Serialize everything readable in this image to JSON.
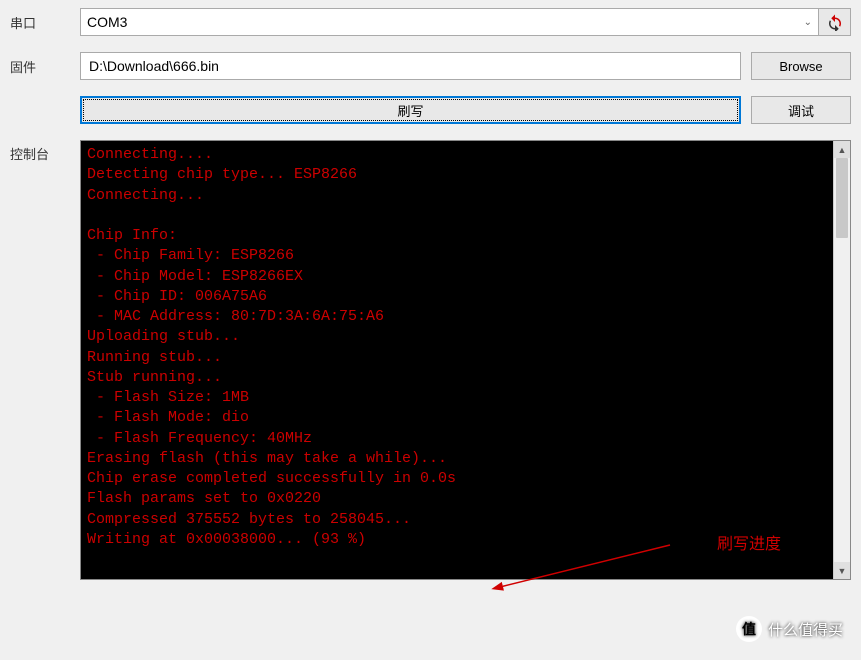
{
  "labels": {
    "serial": "串口",
    "firmware": "固件",
    "console": "控制台"
  },
  "serial": {
    "selected": "COM3"
  },
  "firmware": {
    "path": "D:\\Download\\666.bin"
  },
  "buttons": {
    "browse": "Browse",
    "flash": "刷写",
    "debug": "调试"
  },
  "console_lines": [
    "Connecting....",
    "Detecting chip type... ESP8266",
    "Connecting...",
    "",
    "Chip Info:",
    " - Chip Family: ESP8266",
    " - Chip Model: ESP8266EX",
    " - Chip ID: 006A75A6",
    " - MAC Address: 80:7D:3A:6A:75:A6",
    "Uploading stub...",
    "Running stub...",
    "Stub running...",
    " - Flash Size: 1MB",
    " - Flash Mode: dio",
    " - Flash Frequency: 40MHz",
    "Erasing flash (this may take a while)...",
    "Chip erase completed successfully in 0.0s",
    "Flash params set to 0x0220",
    "Compressed 375552 bytes to 258045...",
    "Writing at 0x00038000... (93 %)"
  ],
  "annotation": {
    "text": "刷写进度"
  },
  "watermark": {
    "badge": "值",
    "text": "什么值得买"
  }
}
